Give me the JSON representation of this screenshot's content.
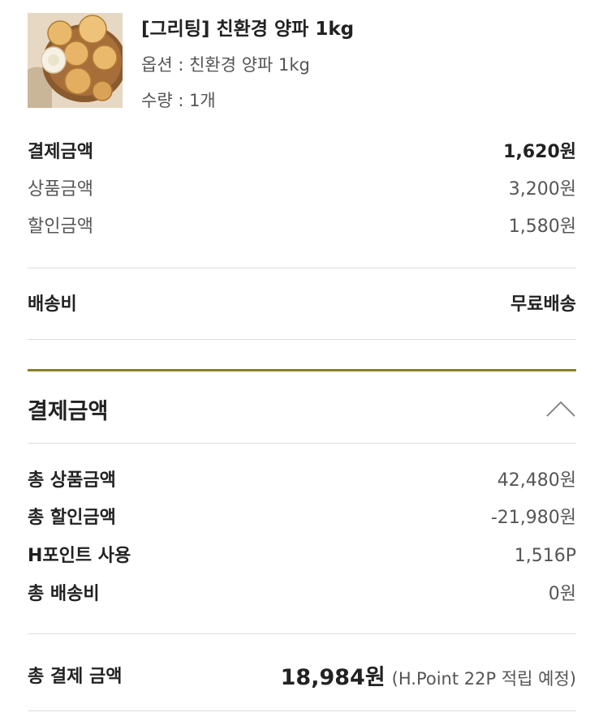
{
  "product": {
    "image_alt": "onions-in-wooden-bowl",
    "title": "[그리팅] 친환경 양파 1kg",
    "option": "옵션 : 친환경 양파 1kg",
    "quantity": "수량 : 1개"
  },
  "item_prices": {
    "payment": {
      "label": "결제금액",
      "value": "1,620원"
    },
    "product": {
      "label": "상품금액",
      "value": "3,200원"
    },
    "discount": {
      "label": "할인금액",
      "value": "1,580원"
    }
  },
  "shipping": {
    "label": "배송비",
    "value": "무료배송"
  },
  "summary": {
    "title": "결제금액",
    "toggle_icon": "chevron-up-icon",
    "rows": [
      {
        "label": "총 상품금액",
        "value": "42,480원"
      },
      {
        "label": "총 할인금액",
        "value": "-21,980원"
      },
      {
        "label": "H포인트 사용",
        "value": "1,516P"
      },
      {
        "label": "총 배송비",
        "value": "0원"
      }
    ],
    "total": {
      "label": "총 결제 금액",
      "amount": "18,984원",
      "note": "(H.Point 22P 적립 예정)"
    }
  },
  "colors": {
    "accent_divider": "#8a7f28",
    "text_primary": "#222222",
    "text_secondary": "#555555",
    "divider": "#dddddd"
  }
}
